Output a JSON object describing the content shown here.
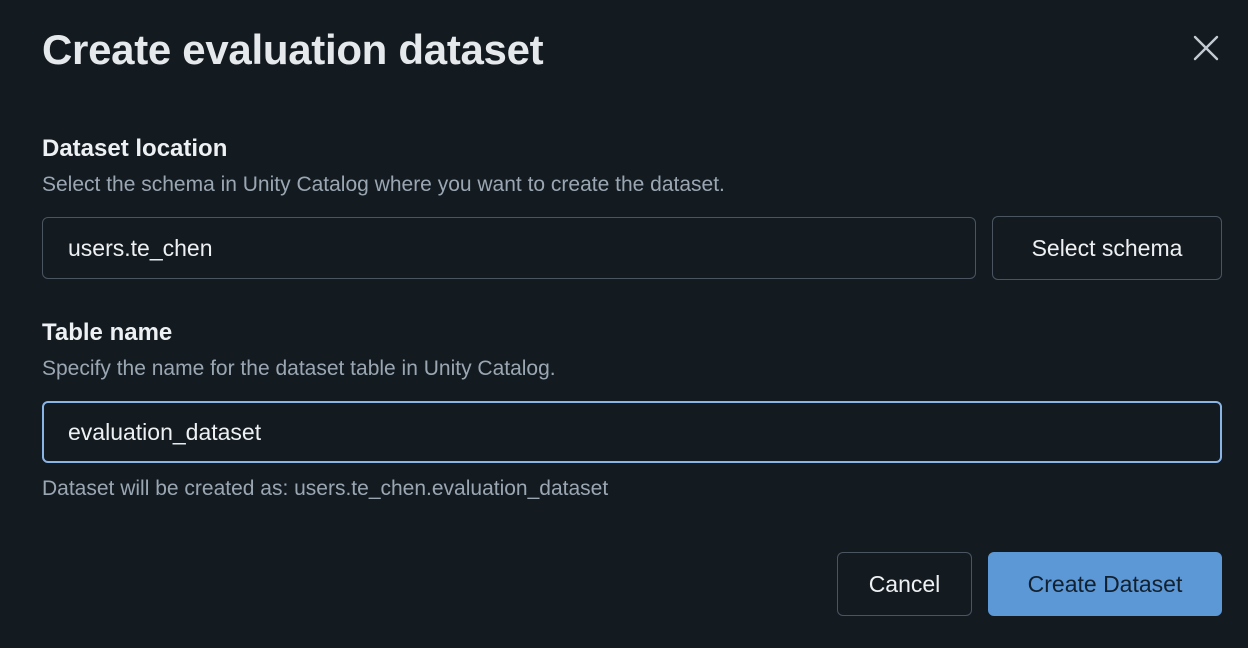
{
  "dialog": {
    "title": "Create evaluation dataset",
    "close_icon": "close-icon"
  },
  "location": {
    "label": "Dataset location",
    "description": "Select the schema in Unity Catalog where you want to create the dataset.",
    "value": "users.te_chen",
    "select_button": "Select schema"
  },
  "table": {
    "label": "Table name",
    "description": "Specify the name for the dataset table in Unity Catalog.",
    "value": "evaluation_dataset",
    "hint": "Dataset will be created as: users.te_chen.evaluation_dataset"
  },
  "footer": {
    "cancel_label": "Cancel",
    "create_label": "Create Dataset"
  },
  "colors": {
    "background": "#131a20",
    "primary": "#5c97d6",
    "focus_border": "#8ab4e6",
    "muted_text": "#9aa7b3"
  }
}
